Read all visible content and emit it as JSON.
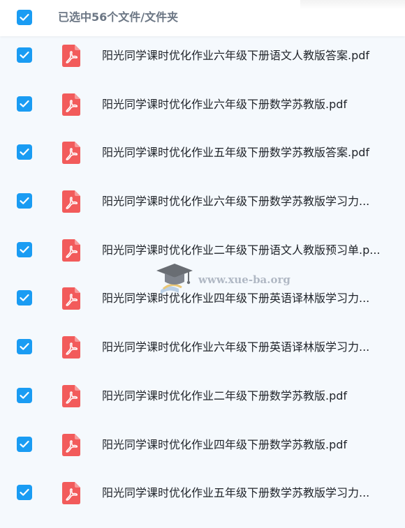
{
  "header": {
    "selected_text": "已选中56个文件/文件夹"
  },
  "files": [
    {
      "name": "阳光同学课时优化作业六年级下册语文人教版答案.pdf",
      "icon": "pdf-icon",
      "checked": true
    },
    {
      "name": "阳光同学课时优化作业六年级下册数学苏教版.pdf",
      "icon": "pdf-icon",
      "checked": true
    },
    {
      "name": "阳光同学课时优化作业五年级下册数学苏教版答案.pdf",
      "icon": "pdf-icon",
      "checked": true
    },
    {
      "name": "阳光同学课时优化作业六年级下册数学苏教版学习力...",
      "icon": "pdf-icon",
      "checked": true
    },
    {
      "name": "阳光同学课时优化作业二年级下册语文人教版预习单.p...",
      "icon": "pdf-icon",
      "checked": true
    },
    {
      "name": "阳光同学课时优化作业四年级下册英语译林版学习力...",
      "icon": "pdf-icon",
      "checked": true
    },
    {
      "name": "阳光同学课时优化作业六年级下册英语译林版学习力...",
      "icon": "pdf-icon",
      "checked": true
    },
    {
      "name": "阳光同学课时优化作业二年级下册数学苏教版.pdf",
      "icon": "pdf-icon",
      "checked": true
    },
    {
      "name": "阳光同学课时优化作业四年级下册数学苏教版.pdf",
      "icon": "pdf-icon",
      "checked": true
    },
    {
      "name": "阳光同学课时优化作业五年级下册数学苏教版学习力...",
      "icon": "pdf-icon",
      "checked": true
    }
  ],
  "watermark": {
    "text": "www.xue-ba.org"
  },
  "colors": {
    "checkbox": "#1a9cf3",
    "pdf_icon": "#f25b5b",
    "background": "#f5f9fd"
  }
}
